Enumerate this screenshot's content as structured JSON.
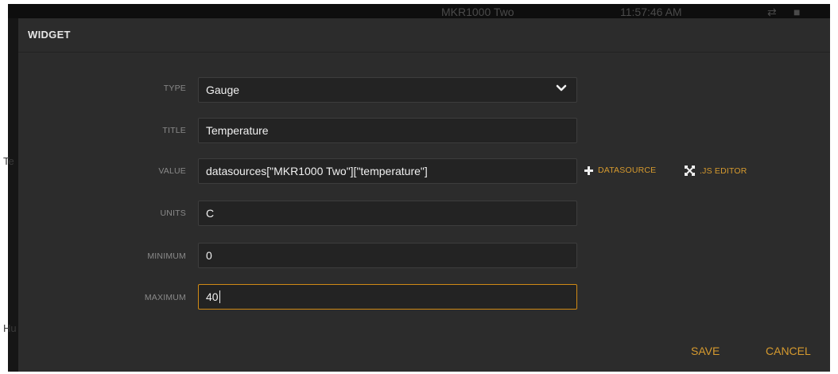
{
  "background": {
    "window_title": "MKR1000 Two",
    "clock": "11:57:46 AM",
    "side_fragments": [
      "Te",
      "Hu"
    ]
  },
  "modal": {
    "title": "WIDGET",
    "fields": [
      {
        "label": "TYPE",
        "value": "Gauge",
        "kind": "select"
      },
      {
        "label": "TITLE",
        "value": "Temperature",
        "kind": "text"
      },
      {
        "label": "VALUE",
        "value": "datasources[\"MKR1000 Two\"][\"temperature\"]",
        "kind": "text"
      },
      {
        "label": "UNITS",
        "value": "C",
        "kind": "text"
      },
      {
        "label": "MINIMUM",
        "value": "0",
        "kind": "text"
      },
      {
        "label": "MAXIMUM",
        "value": "40",
        "kind": "text",
        "focused": true
      }
    ],
    "actions": {
      "datasource_label": "DATASOURCE",
      "datasource_icon": "plus-icon",
      "js_editor_label": ".JS EDITOR",
      "js_editor_icon": "expand-arrows-icon"
    },
    "footer": {
      "save_label": "SAVE",
      "cancel_label": "CANCEL"
    }
  },
  "colors": {
    "accent": "#d69a2e",
    "focus_border": "#d08a15",
    "modal_bg": "#2c2c2c",
    "field_bg": "#232323"
  }
}
